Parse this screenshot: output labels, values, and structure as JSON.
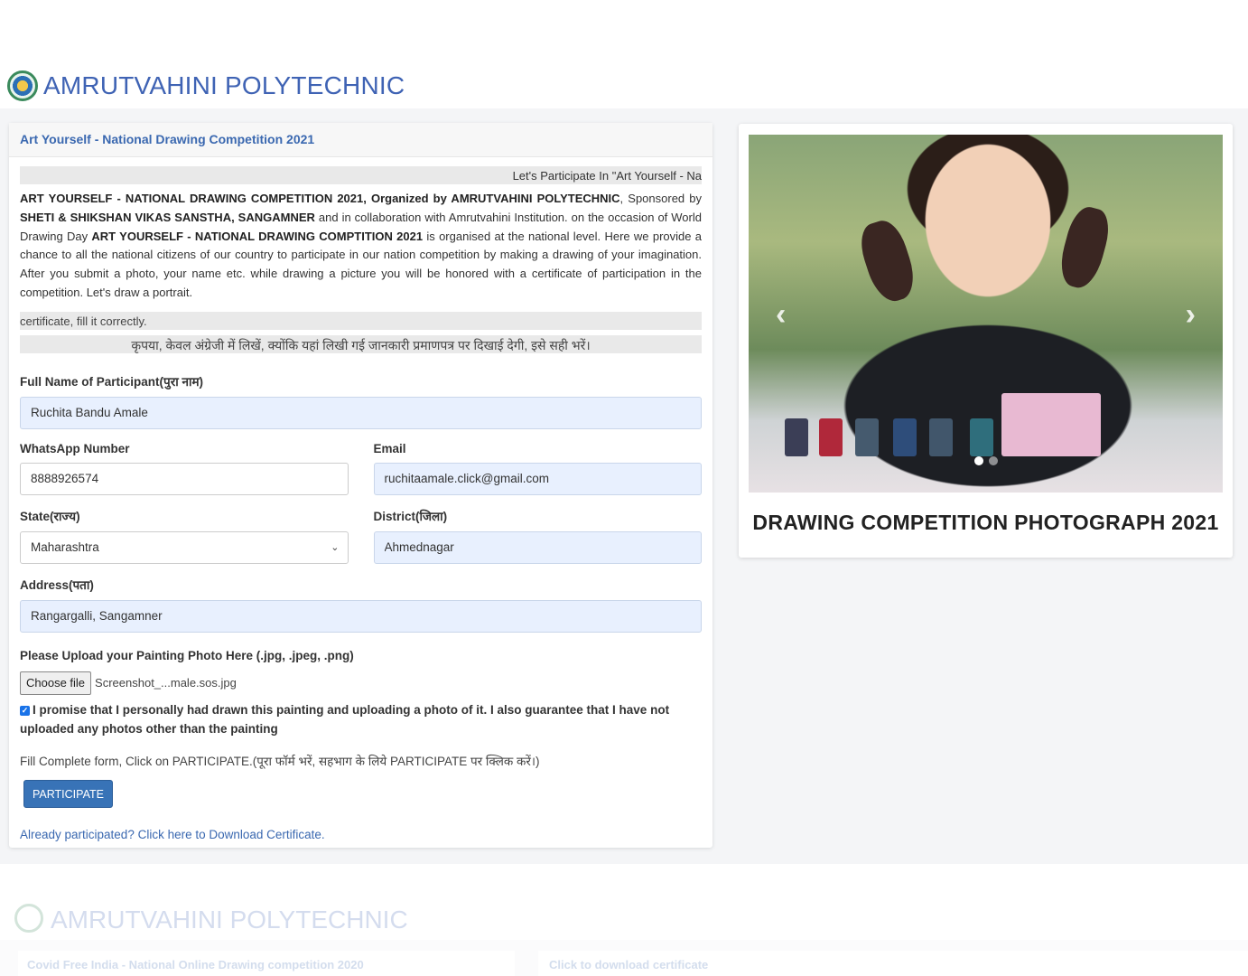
{
  "header": {
    "brand": "AMRUTVAHINI POLYTECHNIC"
  },
  "form_card": {
    "title": "Art Yourself - National Drawing Competition 2021",
    "marquee": "Let's Participate In \"Art Yourself - Na",
    "intro": {
      "b1": "ART YOURSELF - NATIONAL DRAWING COMPETITION 2021, Organized by AMRUTVAHINI POLYTECHNIC",
      "t1": ", Sponsored by ",
      "b2": "SHETI & SHIKSHAN VIKAS SANSTHA, SANGAMNER",
      "t2": " and in collaboration with Amrutvahini Institution. on the occasion of World Drawing Day ",
      "b3": "ART YOURSELF - NATIONAL DRAWING COMPTITION 2021",
      "t3": " is organised at the national level. Here we provide a chance to all the national citizens of our country to participate in our nation competition by making a drawing of your imagination. After you submit a photo, your name etc. while drawing a picture you will be honored with a certificate of participation in the competition. Let's draw a portrait."
    },
    "note_en": "certificate, fill it correctly.",
    "note_hi": "कृपया, केवल अंग्रेजी में लिखें, क्योंकि यहां लिखी गई जानकारी प्रमाणपत्र पर दिखाई देगी, इसे सही भरें।",
    "fields": {
      "full_name": {
        "label": "Full Name of Participant(पुरा नाम)",
        "value": "Ruchita Bandu Amale"
      },
      "whatsapp": {
        "label": "WhatsApp Number",
        "value": "8888926574"
      },
      "email": {
        "label": "Email",
        "value": "ruchitaamale.click@gmail.com"
      },
      "state": {
        "label": "State(राज्य)",
        "value": "Maharashtra"
      },
      "district": {
        "label": "District(जिला)",
        "value": "Ahmednagar"
      },
      "address": {
        "label": "Address(पता)",
        "value": "Rangargalli, Sangamner"
      }
    },
    "upload": {
      "label": "Please Upload your Painting Photo Here (.jpg, .jpeg, .png)",
      "button": "Choose file",
      "filename": "Screenshot_...male.sos.jpg"
    },
    "promise": "I promise that I personally had drawn this painting and uploading a photo of it. I also guarantee that I have not uploaded any photos other than the painting",
    "fill_note": "Fill Complete form, Click on PARTICIPATE.(पूरा फॉर्म भरें, सहभाग के लिये PARTICIPATE पर क्लिक करें।)",
    "participate_label": "PARTICIPATE",
    "download_link": "Already participated? Click here to Download Certificate."
  },
  "photo_card": {
    "caption": "DRAWING COMPETITION PHOTOGRAPH 2021"
  },
  "ghost": {
    "brand": "AMRUTVAHINI POLYTECHNIC",
    "head1": "Covid Free India - National Online Drawing competition 2020",
    "head2": "Click to download certificate"
  }
}
